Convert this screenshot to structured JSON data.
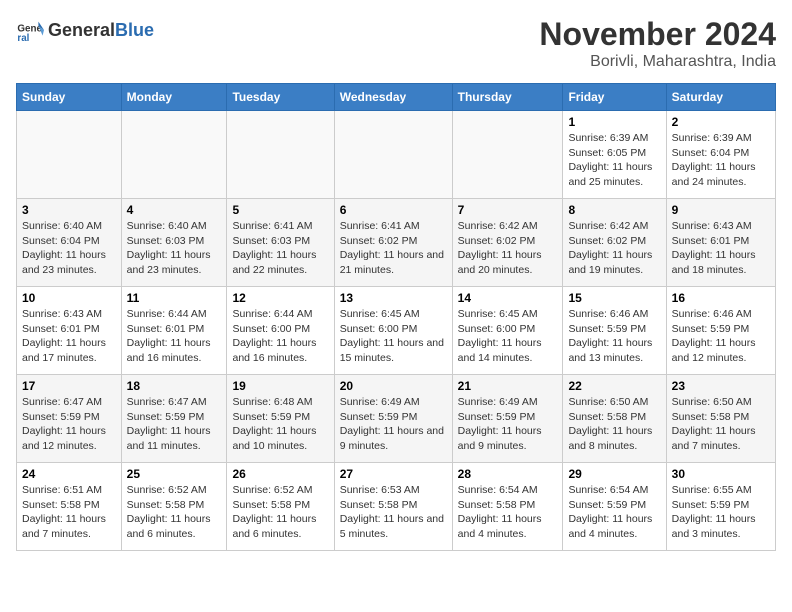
{
  "logo": {
    "general": "General",
    "blue": "Blue"
  },
  "header": {
    "title": "November 2024",
    "subtitle": "Borivli, Maharashtra, India"
  },
  "weekdays": [
    "Sunday",
    "Monday",
    "Tuesday",
    "Wednesday",
    "Thursday",
    "Friday",
    "Saturday"
  ],
  "weeks": [
    [
      {
        "day": "",
        "info": ""
      },
      {
        "day": "",
        "info": ""
      },
      {
        "day": "",
        "info": ""
      },
      {
        "day": "",
        "info": ""
      },
      {
        "day": "",
        "info": ""
      },
      {
        "day": "1",
        "info": "Sunrise: 6:39 AM\nSunset: 6:05 PM\nDaylight: 11 hours and 25 minutes."
      },
      {
        "day": "2",
        "info": "Sunrise: 6:39 AM\nSunset: 6:04 PM\nDaylight: 11 hours and 24 minutes."
      }
    ],
    [
      {
        "day": "3",
        "info": "Sunrise: 6:40 AM\nSunset: 6:04 PM\nDaylight: 11 hours and 23 minutes."
      },
      {
        "day": "4",
        "info": "Sunrise: 6:40 AM\nSunset: 6:03 PM\nDaylight: 11 hours and 23 minutes."
      },
      {
        "day": "5",
        "info": "Sunrise: 6:41 AM\nSunset: 6:03 PM\nDaylight: 11 hours and 22 minutes."
      },
      {
        "day": "6",
        "info": "Sunrise: 6:41 AM\nSunset: 6:02 PM\nDaylight: 11 hours and 21 minutes."
      },
      {
        "day": "7",
        "info": "Sunrise: 6:42 AM\nSunset: 6:02 PM\nDaylight: 11 hours and 20 minutes."
      },
      {
        "day": "8",
        "info": "Sunrise: 6:42 AM\nSunset: 6:02 PM\nDaylight: 11 hours and 19 minutes."
      },
      {
        "day": "9",
        "info": "Sunrise: 6:43 AM\nSunset: 6:01 PM\nDaylight: 11 hours and 18 minutes."
      }
    ],
    [
      {
        "day": "10",
        "info": "Sunrise: 6:43 AM\nSunset: 6:01 PM\nDaylight: 11 hours and 17 minutes."
      },
      {
        "day": "11",
        "info": "Sunrise: 6:44 AM\nSunset: 6:01 PM\nDaylight: 11 hours and 16 minutes."
      },
      {
        "day": "12",
        "info": "Sunrise: 6:44 AM\nSunset: 6:00 PM\nDaylight: 11 hours and 16 minutes."
      },
      {
        "day": "13",
        "info": "Sunrise: 6:45 AM\nSunset: 6:00 PM\nDaylight: 11 hours and 15 minutes."
      },
      {
        "day": "14",
        "info": "Sunrise: 6:45 AM\nSunset: 6:00 PM\nDaylight: 11 hours and 14 minutes."
      },
      {
        "day": "15",
        "info": "Sunrise: 6:46 AM\nSunset: 5:59 PM\nDaylight: 11 hours and 13 minutes."
      },
      {
        "day": "16",
        "info": "Sunrise: 6:46 AM\nSunset: 5:59 PM\nDaylight: 11 hours and 12 minutes."
      }
    ],
    [
      {
        "day": "17",
        "info": "Sunrise: 6:47 AM\nSunset: 5:59 PM\nDaylight: 11 hours and 12 minutes."
      },
      {
        "day": "18",
        "info": "Sunrise: 6:47 AM\nSunset: 5:59 PM\nDaylight: 11 hours and 11 minutes."
      },
      {
        "day": "19",
        "info": "Sunrise: 6:48 AM\nSunset: 5:59 PM\nDaylight: 11 hours and 10 minutes."
      },
      {
        "day": "20",
        "info": "Sunrise: 6:49 AM\nSunset: 5:59 PM\nDaylight: 11 hours and 9 minutes."
      },
      {
        "day": "21",
        "info": "Sunrise: 6:49 AM\nSunset: 5:59 PM\nDaylight: 11 hours and 9 minutes."
      },
      {
        "day": "22",
        "info": "Sunrise: 6:50 AM\nSunset: 5:58 PM\nDaylight: 11 hours and 8 minutes."
      },
      {
        "day": "23",
        "info": "Sunrise: 6:50 AM\nSunset: 5:58 PM\nDaylight: 11 hours and 7 minutes."
      }
    ],
    [
      {
        "day": "24",
        "info": "Sunrise: 6:51 AM\nSunset: 5:58 PM\nDaylight: 11 hours and 7 minutes."
      },
      {
        "day": "25",
        "info": "Sunrise: 6:52 AM\nSunset: 5:58 PM\nDaylight: 11 hours and 6 minutes."
      },
      {
        "day": "26",
        "info": "Sunrise: 6:52 AM\nSunset: 5:58 PM\nDaylight: 11 hours and 6 minutes."
      },
      {
        "day": "27",
        "info": "Sunrise: 6:53 AM\nSunset: 5:58 PM\nDaylight: 11 hours and 5 minutes."
      },
      {
        "day": "28",
        "info": "Sunrise: 6:54 AM\nSunset: 5:58 PM\nDaylight: 11 hours and 4 minutes."
      },
      {
        "day": "29",
        "info": "Sunrise: 6:54 AM\nSunset: 5:59 PM\nDaylight: 11 hours and 4 minutes."
      },
      {
        "day": "30",
        "info": "Sunrise: 6:55 AM\nSunset: 5:59 PM\nDaylight: 11 hours and 3 minutes."
      }
    ]
  ]
}
